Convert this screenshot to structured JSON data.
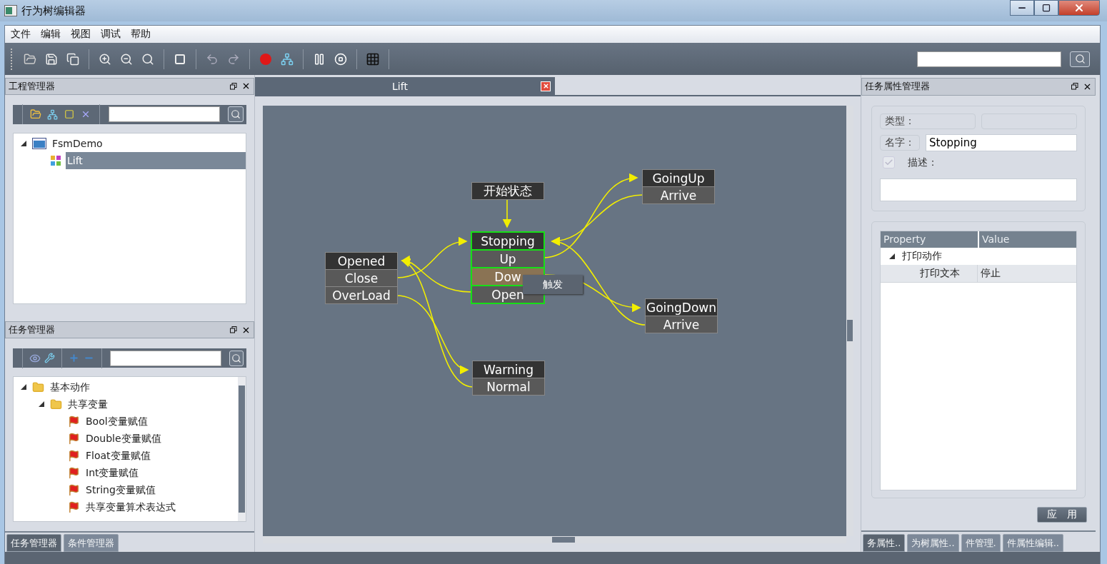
{
  "window": {
    "title": "行为树编辑器"
  },
  "menu": [
    "文件",
    "编辑",
    "视图",
    "调试",
    "帮助"
  ],
  "project_panel": {
    "title": "工程管理器",
    "tree": [
      {
        "label": "FsmDemo",
        "kind": "project",
        "expanded": true,
        "selected": false,
        "children": [
          {
            "label": "Lift",
            "kind": "tree",
            "selected": true
          }
        ]
      }
    ]
  },
  "task_panel": {
    "title": "任务管理器",
    "tree": [
      {
        "label": "基本动作",
        "kind": "folder",
        "expanded": true,
        "selected": false,
        "children": [
          {
            "label": "共享变量",
            "kind": "folder",
            "expanded": true,
            "selected": false,
            "children": [
              {
                "label": "Bool变量赋值",
                "kind": "action",
                "selected": false
              },
              {
                "label": "Double变量赋值",
                "kind": "action",
                "selected": false
              },
              {
                "label": "Float变量赋值",
                "kind": "action",
                "selected": false
              },
              {
                "label": "Int变量赋值",
                "kind": "action",
                "selected": false
              },
              {
                "label": "String变量赋值",
                "kind": "action",
                "selected": false
              },
              {
                "label": "共享变量算术表达式",
                "kind": "action",
                "selected": false
              }
            ]
          }
        ]
      }
    ]
  },
  "left_tabs": [
    {
      "label": "任务管理器",
      "selected": true
    },
    {
      "label": "条件管理器",
      "selected": false
    }
  ],
  "editor_tabs": [
    {
      "label": "Lift",
      "selected": true
    }
  ],
  "canvas": {
    "nodes": [
      {
        "title": "开始状态",
        "kind": "start",
        "selected": false
      },
      {
        "title": "GoingUp",
        "kind": "state",
        "selected": false,
        "rows": [
          {
            "label": "Arrive",
            "hovered": false
          }
        ]
      },
      {
        "title": "Opened",
        "kind": "state",
        "selected": false,
        "rows": [
          {
            "label": "Close",
            "hovered": false
          },
          {
            "label": "OverLoad",
            "hovered": false
          }
        ]
      },
      {
        "title": "Stopping",
        "kind": "state",
        "selected": true,
        "rows": [
          {
            "label": "Up",
            "hovered": false
          },
          {
            "label": "Dow",
            "hovered": true
          },
          {
            "label": "Open",
            "hovered": false
          }
        ]
      },
      {
        "title": "GoingDown",
        "kind": "state",
        "selected": false,
        "rows": [
          {
            "label": "Arrive",
            "hovered": false
          }
        ]
      },
      {
        "title": "Warning",
        "kind": "state",
        "selected": false,
        "rows": [
          {
            "label": "Normal",
            "hovered": false
          }
        ]
      }
    ],
    "tooltip": "触发"
  },
  "properties_panel": {
    "title": "任务属性管理器",
    "type_label": "类型：",
    "name_label": "名字：",
    "name_value": "Stopping",
    "description_label": "描述：",
    "description_checked": true,
    "grid": {
      "columns": [
        "Property",
        "Value"
      ],
      "groups": [
        {
          "label": "打印动作",
          "expanded": true,
          "rows": [
            {
              "property": "打印文本",
              "value": "停止"
            }
          ]
        }
      ]
    },
    "apply_button": "应　用"
  },
  "right_tabs": [
    {
      "label": "务属性..",
      "selected": true
    },
    {
      "label": "为树属性..",
      "selected": false
    },
    {
      "label": "件管理.",
      "selected": false
    },
    {
      "label": "件属性编辑..",
      "selected": false
    }
  ]
}
